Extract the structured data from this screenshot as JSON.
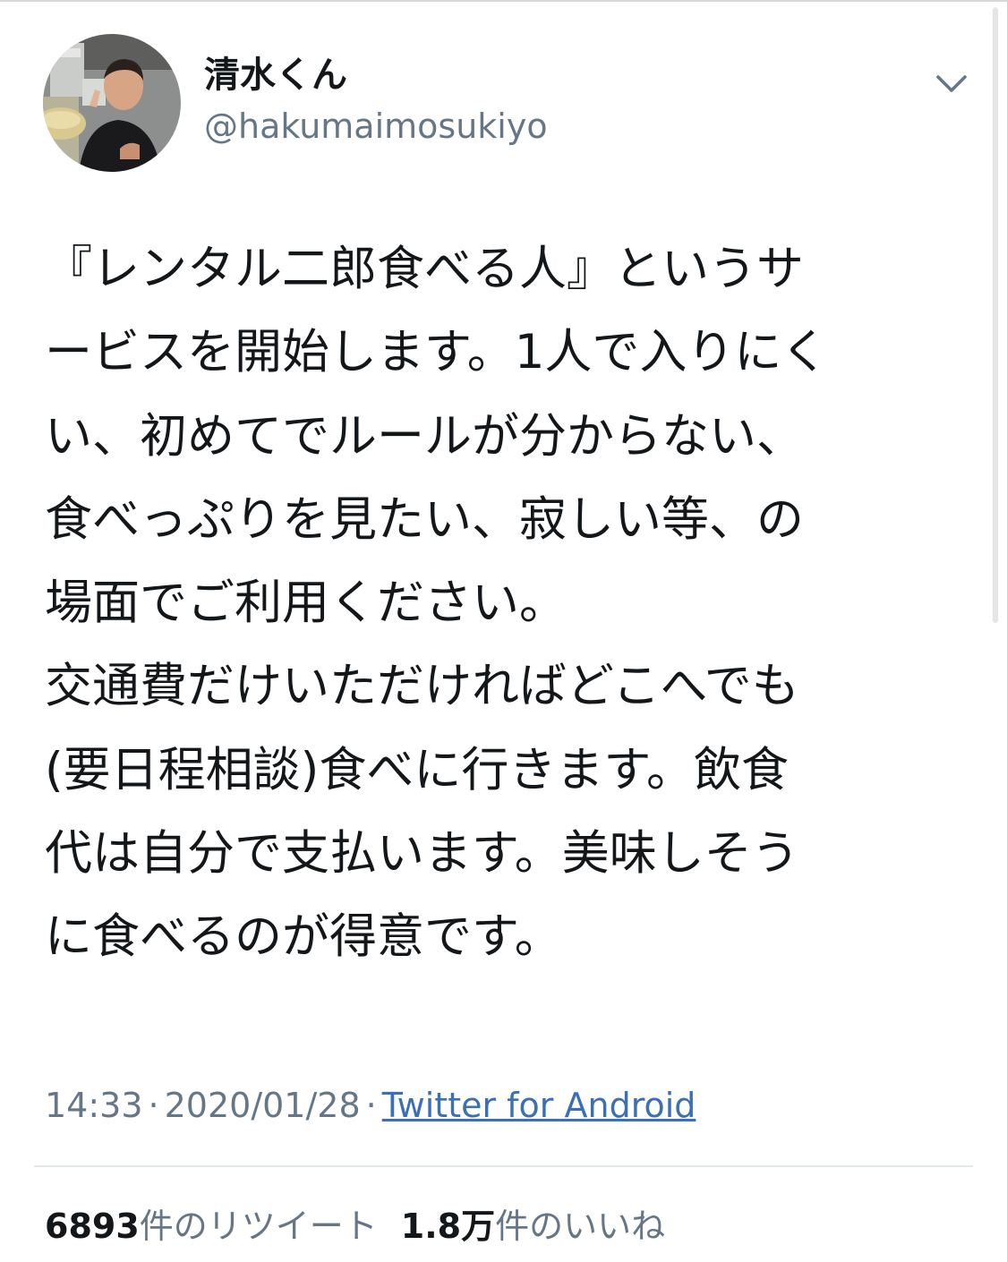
{
  "user": {
    "display_name": "清水くん",
    "handle": "@hakumaimosukiyo",
    "avatar_icon": "profile-photo"
  },
  "menu": {
    "icon": "chevron-down-icon"
  },
  "tweet": {
    "lines": [
      "『レンタル二郎食べる人』というサ",
      "ービスを開始します。1人で入りにく",
      "い、初めてでルールが分からない、",
      "食べっぷりを見たい、寂しい等、の",
      "場面でご利用ください。",
      "交通費だけいただければどこへでも",
      "(要日程相談)食べに行きます。飲食",
      "代は自分で支払います。美味しそう",
      "に食べるのが得意です。"
    ]
  },
  "meta": {
    "time": "14:33",
    "separator": "·",
    "date": "2020/01/28",
    "source": "Twitter for Android"
  },
  "stats": {
    "retweets_count": "6893",
    "retweets_label": "件のリツイート",
    "likes_count": "1.8万",
    "likes_label": "件のいいね"
  },
  "colors": {
    "text": "#14171a",
    "secondary": "#657786",
    "link": "#3b6fb6",
    "divider": "#e1e8ed"
  }
}
